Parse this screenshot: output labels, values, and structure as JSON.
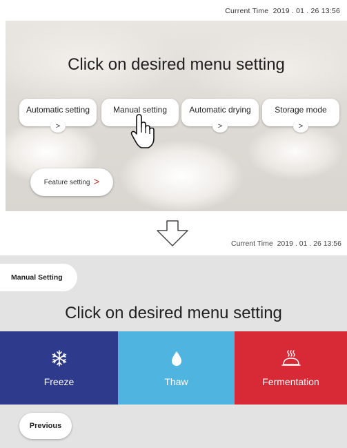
{
  "top_screen": {
    "current_time_label": "Current Time",
    "current_time_value": "2019 . 01 . 26  13:56",
    "title": "Click on desired menu setting",
    "menu_items": [
      {
        "label": "Automatic setting",
        "icon": "chevron-right-icon"
      },
      {
        "label": "Manual setting",
        "icon": "chevron-right-icon"
      },
      {
        "label": "Automatic drying",
        "icon": "chevron-right-icon"
      },
      {
        "label": "Storage mode",
        "icon": "chevron-right-icon"
      }
    ],
    "feature_setting_label": "Feature setting",
    "cursor_icon": "hand-pointer-icon"
  },
  "transition_icon": "down-arrow-icon",
  "bottom_screen": {
    "current_time_label": "Current Time",
    "current_time_value": "2019 . 01 . 26  13:56",
    "screen_tag": "Manual Setting",
    "title": "Click on desired menu setting",
    "tiles": [
      {
        "label": "Freeze",
        "icon": "snowflake-icon",
        "color": "#2e3a8c"
      },
      {
        "label": "Thaw",
        "icon": "water-drop-icon",
        "color": "#4fb4e0"
      },
      {
        "label": "Fermentation",
        "icon": "bread-icon",
        "color": "#d72a36"
      }
    ],
    "previous_label": "Previous"
  }
}
